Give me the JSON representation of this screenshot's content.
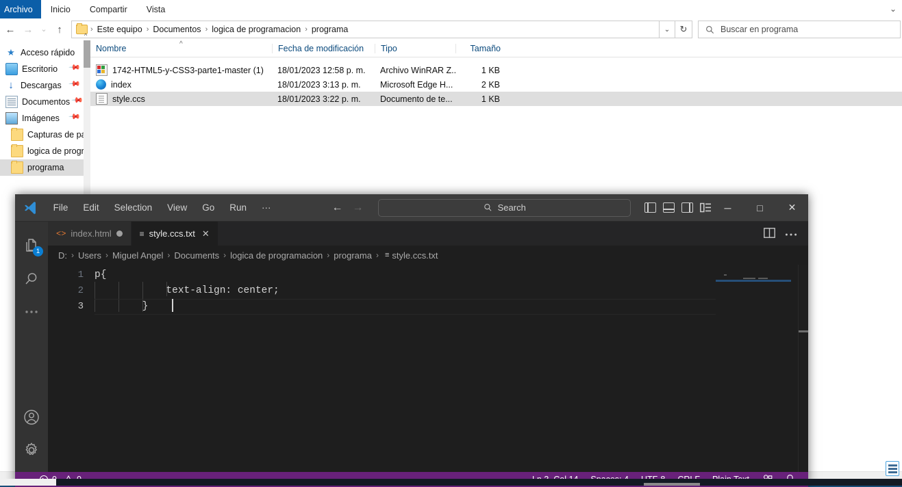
{
  "desktop": {
    "icons": [
      {
        "name": "edge-desktop-icon"
      },
      {
        "name": "this-pc-desktop-icon"
      }
    ]
  },
  "explorer": {
    "ribbon": {
      "tabs": [
        {
          "label": "Archivo",
          "key": "file"
        },
        {
          "label": "Inicio",
          "key": "home"
        },
        {
          "label": "Compartir",
          "key": "share"
        },
        {
          "label": "Vista",
          "key": "view"
        }
      ],
      "expand_caret": "⌄"
    },
    "nav": {
      "back_icon": "←",
      "forward_icon": "→",
      "recent_icon": "⌄",
      "up_icon": "↑",
      "dropdown_icon": "⌄",
      "refresh_icon": "↻"
    },
    "address": {
      "crumbs": [
        "Este equipo",
        "Documentos",
        "logica de programacion",
        "programa"
      ],
      "separator": "›"
    },
    "search": {
      "placeholder": "Buscar en programa",
      "icon": "search-icon"
    },
    "sidebar": {
      "items": [
        {
          "label": "Acceso rápido",
          "icon": "star-icon",
          "pinned": false,
          "selected": false
        },
        {
          "label": "Escritorio",
          "icon": "desktop-icon",
          "pinned": true,
          "selected": false
        },
        {
          "label": "Descargas",
          "icon": "downloads-icon",
          "pinned": true,
          "selected": false
        },
        {
          "label": "Documentos",
          "icon": "documents-icon",
          "pinned": true,
          "selected": false
        },
        {
          "label": "Imágenes",
          "icon": "pictures-icon",
          "pinned": true,
          "selected": false
        },
        {
          "label": "Capturas de pan",
          "icon": "folder-icon",
          "pinned": false,
          "selected": false
        },
        {
          "label": "logica de progra",
          "icon": "folder-icon",
          "pinned": false,
          "selected": false
        },
        {
          "label": "programa",
          "icon": "folder-icon",
          "pinned": false,
          "selected": true
        }
      ]
    },
    "columns": [
      {
        "label": "Nombre",
        "key": "name"
      },
      {
        "label": "Fecha de modificación",
        "key": "date"
      },
      {
        "label": "Tipo",
        "key": "type"
      },
      {
        "label": "Tamaño",
        "key": "size"
      }
    ],
    "files": [
      {
        "name": "1742-HTML5-y-CSS3-parte1-master (1)",
        "date": "18/01/2023 12:58 p. m.",
        "type": "Archivo WinRAR Z...",
        "size": "1 KB",
        "icon": "winrar-archive-icon",
        "selected": false
      },
      {
        "name": "index",
        "date": "18/01/2023 3:13 p. m.",
        "type": "Microsoft Edge H...",
        "size": "2 KB",
        "icon": "edge-html-icon",
        "selected": false
      },
      {
        "name": "style.ccs",
        "date": "18/01/2023 3:22 p. m.",
        "type": "Documento de te...",
        "size": "1 KB",
        "icon": "text-document-icon",
        "selected": true
      }
    ]
  },
  "vscode": {
    "menu": [
      "File",
      "Edit",
      "Selection",
      "View",
      "Go",
      "Run",
      "···"
    ],
    "nav": {
      "back": "←",
      "forward": "→"
    },
    "search": {
      "placeholder": "Search",
      "icon": "search-icon"
    },
    "layout_icons": [
      "toggle-primary-sidebar-icon",
      "toggle-panel-icon",
      "toggle-secondary-sidebar-icon",
      "customize-layout-icon"
    ],
    "window_controls": {
      "minimize": "─",
      "maximize": "□",
      "close": "✕"
    },
    "activitybar": [
      {
        "name": "explorer-icon",
        "badge": "1"
      },
      {
        "name": "search-icon",
        "badge": ""
      },
      {
        "name": "more-views-icon",
        "badge": ""
      },
      {
        "name": "accounts-icon",
        "badge": ""
      },
      {
        "name": "manage-settings-icon",
        "badge": ""
      }
    ],
    "tabs": [
      {
        "label": "index.html",
        "icon": "html-file-icon",
        "dirty": true,
        "active": false
      },
      {
        "label": "style.ccs.txt",
        "icon": "text-file-icon",
        "dirty": false,
        "active": true,
        "close": "✕"
      }
    ],
    "tabs_actions": [
      "split-editor-icon",
      "more-actions-icon"
    ],
    "breadcrumb": {
      "parts": [
        "D:",
        "Users",
        "Miguel Angel",
        "Documents",
        "logica de programacion",
        "programa"
      ],
      "file": "style.ccs.txt",
      "separator": "›"
    },
    "editor": {
      "lines": [
        {
          "num": "1",
          "text": "p{",
          "current": false
        },
        {
          "num": "2",
          "text": "            text-align: center;",
          "current": false
        },
        {
          "num": "3",
          "text": "        }",
          "current": true
        }
      ]
    },
    "statusbar": {
      "errors_icon": "error-icon",
      "errors": "0",
      "warnings_icon": "warning-icon",
      "warnings": "0",
      "position": "Ln 3, Col 14",
      "indentation": "Spaces: 4",
      "encoding": "UTF-8",
      "eol": "CRLF",
      "language": "Plain Text",
      "feedback_icon": "feedback-icon",
      "notifications_icon": "bell-icon"
    }
  },
  "colors": {
    "vscode_statusbar": "#68217a",
    "vscode_titlebar": "#3c3c3c",
    "vscode_editor": "#1e1e1e",
    "explorer_accent": "#0b5ea8",
    "badge_blue": "#0a7fd4"
  }
}
